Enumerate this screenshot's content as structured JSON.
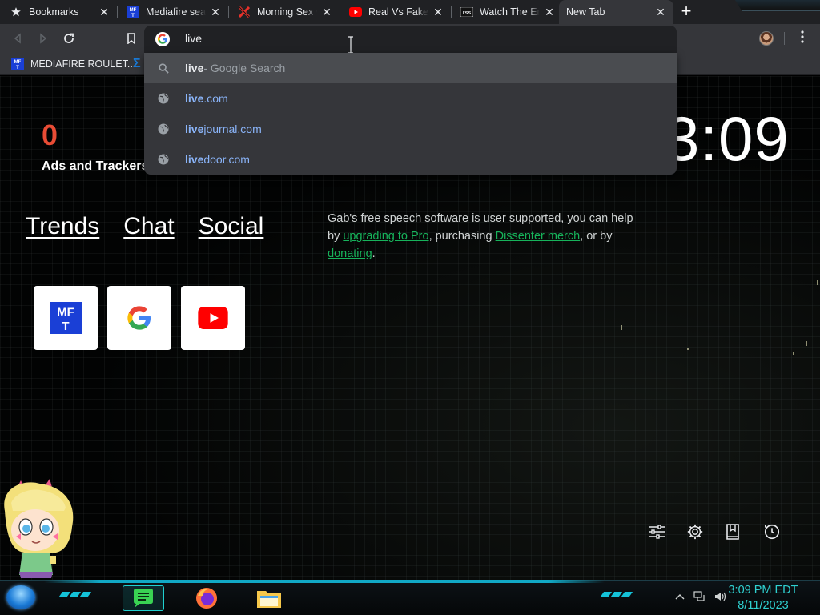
{
  "tabs": [
    {
      "title": "Bookmarks",
      "icon": "star-icon"
    },
    {
      "title": "Mediafire search",
      "icon": "mft-icon"
    },
    {
      "title": "Morning Sex with",
      "icon": "x-icon"
    },
    {
      "title": "Real Vs Fake Co",
      "icon": "youtube-icon"
    },
    {
      "title": "Watch The Eric",
      "icon": "rss-icon"
    },
    {
      "title": "New Tab",
      "icon": ""
    }
  ],
  "omnibox": {
    "value": "live"
  },
  "bookmarks": [
    {
      "label": "MEDIAFIRE ROULET..."
    }
  ],
  "suggestions": [
    {
      "match": "live",
      "rest": " - Google Search",
      "type": "search"
    },
    {
      "match": "live",
      "rest": ".com",
      "type": "url"
    },
    {
      "match": "live",
      "rest": "journal.com",
      "type": "url"
    },
    {
      "match": "live",
      "rest": "door.com",
      "type": "url"
    }
  ],
  "page": {
    "tracker_count": "0",
    "tracker_label": "Ads and Trackers",
    "clock": "3:09",
    "nav_links": [
      "Trends",
      "Chat",
      "Social"
    ],
    "gab_message": {
      "p1": "Gab's free speech software is user supported, you can help by ",
      "link1": "upgrading to Pro",
      "p2": ", purchasing ",
      "link2": "Dissenter merch",
      "p3": ", or by ",
      "link3": "donating",
      "p4": "."
    },
    "tiles": [
      "mediafire-tile",
      "google-tile",
      "youtube-tile"
    ]
  },
  "taskbar": {
    "time": "3:09 PM EDT",
    "date": "8/11/2023"
  },
  "colors": {
    "accent_blue": "#8ab4f8",
    "counter_red": "#e94c35",
    "gab_green": "#17b35b",
    "taskbar_cyan": "#2fd0d0"
  }
}
